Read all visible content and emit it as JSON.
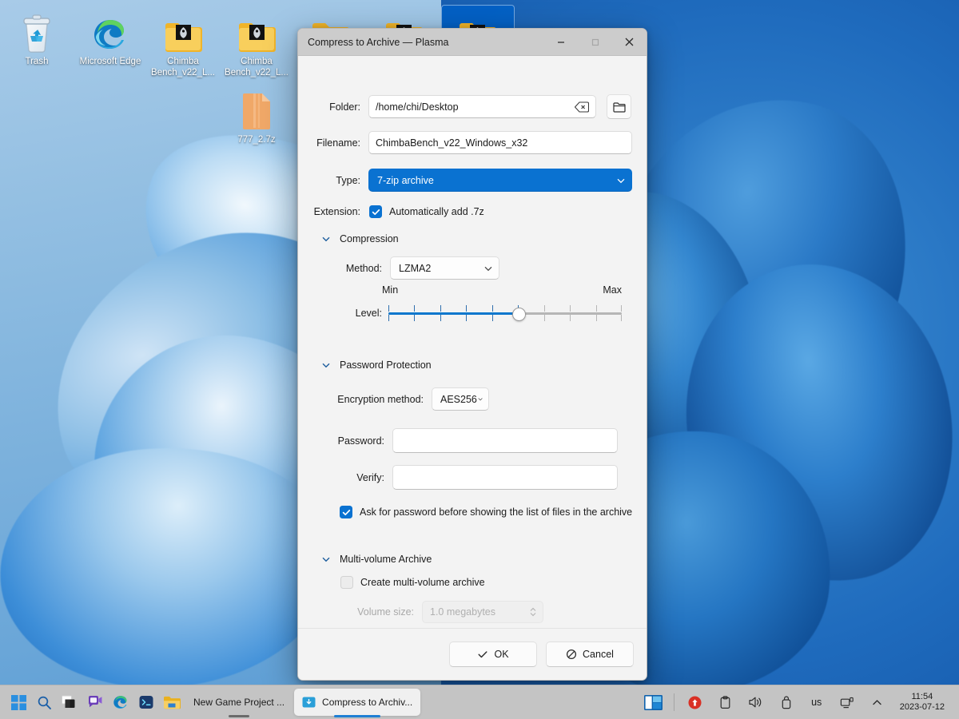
{
  "desktop": {
    "icons": [
      {
        "name": "Trash",
        "label": "Trash",
        "type": "trash"
      },
      {
        "name": "Microsoft Edge",
        "label": "Microsoft Edge",
        "type": "edge"
      },
      {
        "name": "ChimbaBench_v22_L",
        "label": "Chimba Bench_v22_L...",
        "type": "folder-dark"
      },
      {
        "name": "ChimbaBench_v22_L2",
        "label": "Chimba Bench_v22_L...",
        "type": "folder-dark"
      },
      {
        "name": "777_2.7z",
        "label": "777_2.7z",
        "type": "archive"
      }
    ],
    "partial_icons": [
      {
        "type": "folder-gear",
        "selected": false
      },
      {
        "type": "folder-dark",
        "selected": false
      },
      {
        "type": "folder-dark",
        "selected": true
      }
    ]
  },
  "dialog": {
    "title": "Compress to Archive — Plasma",
    "window_buttons": {
      "minimize": "minimize-icon",
      "maximize": "maximize-icon",
      "close": "close-icon",
      "maximize_disabled": true
    },
    "fields": {
      "folder_label": "Folder:",
      "folder_value": "/home/chi/Desktop",
      "folder_clear_icon": "backspace-clear-icon",
      "folder_browse_icon": "folder-open-icon",
      "filename_label": "Filename:",
      "filename_value": "ChimbaBench_v22_Windows_x32",
      "type_label": "Type:",
      "type_value": "7-zip archive",
      "extension_label": "Extension:",
      "extension_checkbox_label": "Automatically add .7z",
      "extension_checked": true
    },
    "compression": {
      "section_title": "Compression",
      "expanded": true,
      "method_label": "Method:",
      "method_value": "LZMA2",
      "level_label": "Level:",
      "min_label": "Min",
      "max_label": "Max",
      "level_value": 5,
      "level_min": 0,
      "level_max": 9
    },
    "password": {
      "section_title": "Password Protection",
      "expanded": true,
      "encryption_label": "Encryption method:",
      "encryption_value": "AES256",
      "password_label": "Password:",
      "password_value": "",
      "verify_label": "Verify:",
      "verify_value": "",
      "ask_checkbox_label": "Ask for password before showing the list of files in the archive",
      "ask_checked": true
    },
    "multivolume": {
      "section_title": "Multi-volume Archive",
      "expanded": true,
      "create_checkbox_label": "Create multi-volume archive",
      "create_checked": false,
      "volume_size_label": "Volume size:",
      "volume_size_value": "1.0 megabytes",
      "volume_size_disabled": true
    },
    "buttons": {
      "ok_label": "OK",
      "ok_icon": "check-icon",
      "cancel_label": "Cancel",
      "cancel_icon": "ban-icon"
    },
    "accent_color": "#0a72d1"
  },
  "taskbar": {
    "start_icon": "windows-start-icon",
    "pinned": [
      {
        "icon": "search-icon",
        "name": "search"
      },
      {
        "icon": "task-view-icon",
        "name": "task-view"
      },
      {
        "icon": "chat-icon",
        "name": "chat"
      },
      {
        "icon": "edge-icon",
        "name": "microsoft-edge"
      },
      {
        "icon": "terminal-icon",
        "name": "terminal"
      },
      {
        "icon": "file-explorer-icon",
        "name": "file-explorer"
      }
    ],
    "tasks": [
      {
        "label": "New Game Project ...",
        "active": false,
        "icon": "folder-icon"
      },
      {
        "label": "Compress to Archiv...",
        "active": true,
        "icon": "archive-icon"
      }
    ],
    "tray": [
      {
        "icon": "update-alert-icon",
        "name": "update-alert",
        "color": "#d93025"
      },
      {
        "icon": "clipboard-icon",
        "name": "clipboard"
      },
      {
        "icon": "volume-icon",
        "name": "volume"
      },
      {
        "icon": "usb-eject-icon",
        "name": "removable-device"
      },
      {
        "icon": "keyboard-layout-icon",
        "name": "keyboard-layout",
        "text": "us"
      },
      {
        "icon": "network-icon",
        "name": "network"
      },
      {
        "icon": "chevron-up-icon",
        "name": "show-hidden-icons"
      }
    ],
    "widgets_icon": "widgets-icon",
    "clock": {
      "time": "11:54",
      "date": "2023-07-12"
    }
  }
}
